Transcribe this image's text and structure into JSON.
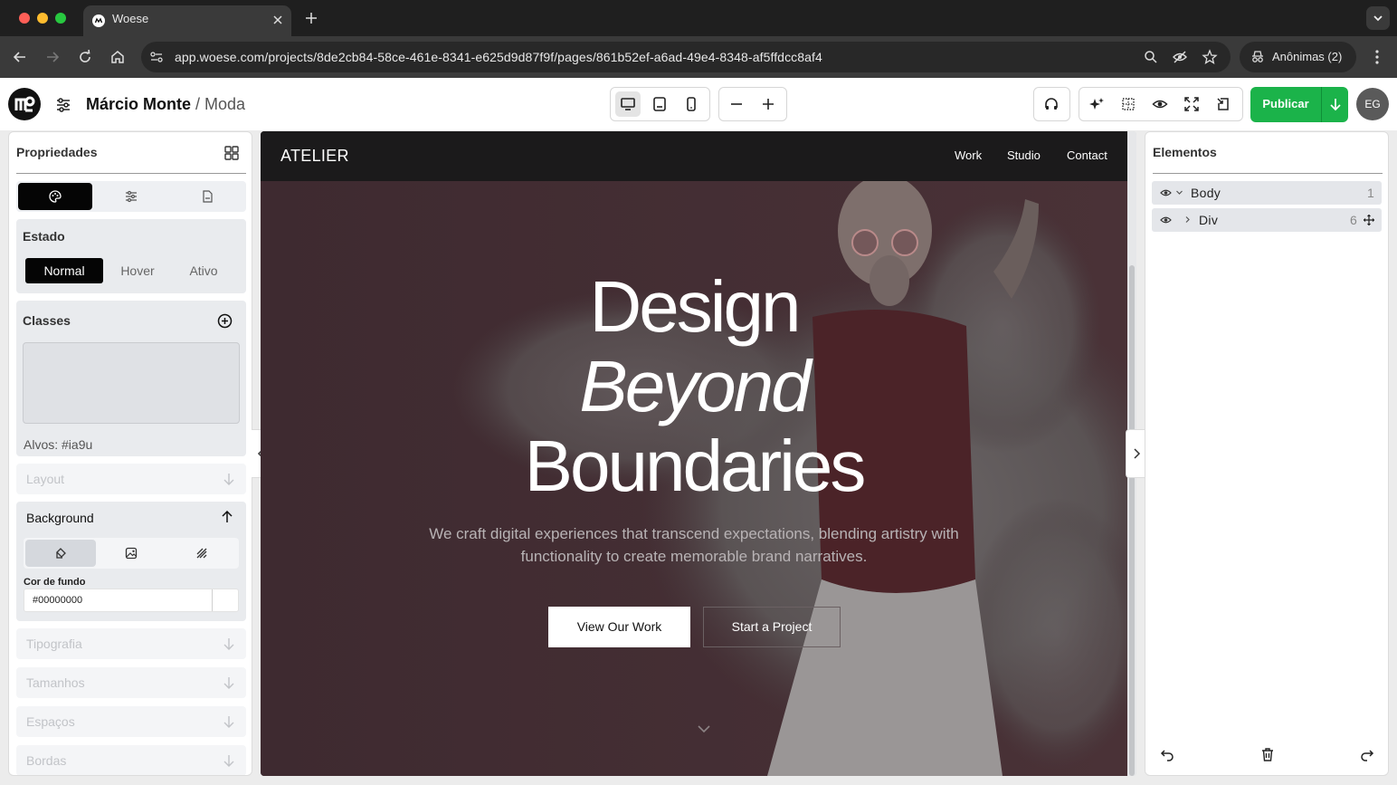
{
  "browser": {
    "tab_title": "Woese",
    "url": "app.woese.com/projects/8de2cb84-58ce-461e-8341-e625d9d87f9f/pages/861b52ef-a6ad-49e4-8348-af5ffdcc8af4",
    "incognito_label": "Anônimas (2)"
  },
  "header": {
    "project_name": "Márcio Monte",
    "separator": " / ",
    "page_name": "Moda",
    "publish_label": "Publicar",
    "avatar_initials": "EG"
  },
  "left_panel": {
    "title": "Propriedades",
    "state": {
      "title": "Estado",
      "options": [
        "Normal",
        "Hover",
        "Ativo"
      ],
      "selected": "Normal"
    },
    "classes": {
      "title": "Classes",
      "targets": "Alvos: #ia9u"
    },
    "sections": {
      "layout": "Layout",
      "background": "Background",
      "typography": "Tipografia",
      "sizes": "Tamanhos",
      "spacing": "Espaços",
      "borders": "Bordas"
    },
    "background": {
      "color_label": "Cor de fundo",
      "color_value": "#00000000"
    }
  },
  "site": {
    "brand": "ATELIER",
    "nav": [
      "Work",
      "Studio",
      "Contact"
    ],
    "hero": {
      "line1": "Design",
      "line2": "Beyond",
      "line3": "Boundaries",
      "subtitle": "We craft digital experiences that transcend expectations, blending artistry with functionality to create memorable brand narratives.",
      "primary_cta": "View Our Work",
      "secondary_cta": "Start a Project"
    }
  },
  "right_panel": {
    "title": "Elementos",
    "tree": [
      {
        "label": "Body",
        "count": "1"
      },
      {
        "label": "Div",
        "count": "6"
      }
    ]
  },
  "colors": {
    "publish": "#1bb34a",
    "active_tab": "#050505",
    "hero_overlay": "#3f2c31"
  }
}
